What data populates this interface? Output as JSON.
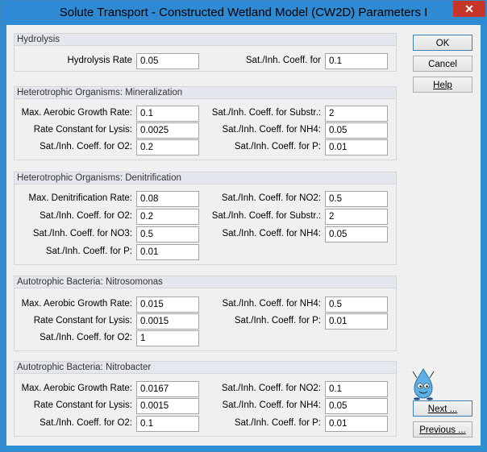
{
  "window": {
    "title": "Solute Transport - Constructed Wetland Model (CW2D) Parameters I",
    "close_glyph": "✕"
  },
  "buttons": {
    "ok": "OK",
    "cancel": "Cancel",
    "help": "Help",
    "next": "Next ...",
    "previous": "Previous ..."
  },
  "hydrolysis": {
    "title": "Hydrolysis",
    "rate_label": "Hydrolysis Rate",
    "rate": "0.05",
    "sat_label": "Sat./Inh. Coeff. for",
    "sat": "0.1"
  },
  "hetero_min": {
    "title": "Heterotrophic Organisms: Mineralization",
    "l1": "Max. Aerobic Growth Rate:",
    "v1": "0.1",
    "l2": "Rate Constant for Lysis:",
    "v2": "0.0025",
    "l3": "Sat./Inh. Coeff. for O2:",
    "v3": "0.2",
    "r1": "Sat./Inh. Coeff. for Substr.:",
    "w1": "2",
    "r2": "Sat./Inh. Coeff. for NH4:",
    "w2": "0.05",
    "r3": "Sat./Inh. Coeff. for P:",
    "w3": "0.01"
  },
  "hetero_den": {
    "title": "Heterotrophic Organisms: Denitrification",
    "l1": "Max. Denitrification Rate:",
    "v1": "0.08",
    "l2": "Sat./Inh. Coeff. for O2:",
    "v2": "0.2",
    "l3": "Sat./Inh. Coeff. for NO3:",
    "v3": "0.5",
    "l4": "Sat./Inh. Coeff. for P:",
    "v4": "0.01",
    "r1": "Sat./Inh. Coeff. for NO2:",
    "w1": "0.5",
    "r2": "Sat./Inh. Coeff. for Substr.:",
    "w2": "2",
    "r3": "Sat./Inh. Coeff. for NH4:",
    "w3": "0.05"
  },
  "nitroso": {
    "title": "Autotrophic Bacteria: Nitrosomonas",
    "l1": "Max. Aerobic Growth Rate:",
    "v1": "0.015",
    "l2": "Rate Constant for Lysis:",
    "v2": "0.0015",
    "l3": "Sat./Inh. Coeff. for O2:",
    "v3": "1",
    "r1": "Sat./Inh. Coeff. for NH4:",
    "w1": "0.5",
    "r2": "Sat./Inh. Coeff. for P:",
    "w2": "0.01"
  },
  "nitrobacter": {
    "title": "Autotrophic Bacteria: Nitrobacter",
    "l1": "Max. Aerobic Growth Rate:",
    "v1": "0.0167",
    "l2": "Rate Constant for Lysis:",
    "v2": "0.0015",
    "l3": "Sat./Inh. Coeff. for O2:",
    "v3": "0.1",
    "r1": "Sat./Inh. Coeff. for NO2:",
    "w1": "0.1",
    "r2": "Sat./Inh. Coeff. for NH4:",
    "w2": "0.05",
    "r3": "Sat./Inh. Coeff. for P:",
    "w3": "0.01"
  },
  "mascot": {
    "icon": "water-drop-mascot-icon"
  }
}
